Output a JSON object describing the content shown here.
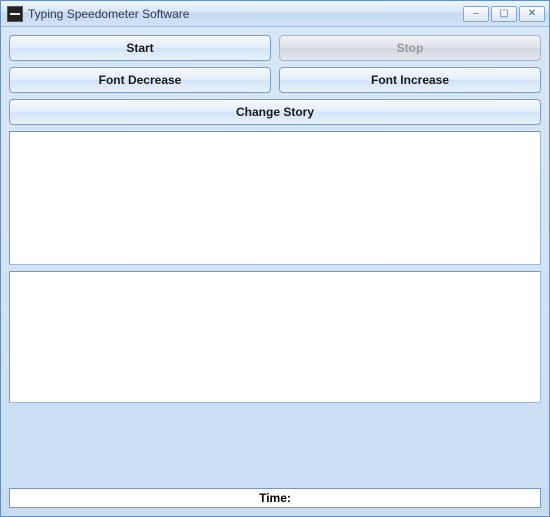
{
  "window": {
    "title": "Typing Speedometer Software"
  },
  "buttons": {
    "start": "Start",
    "stop": "Stop",
    "font_decrease": "Font Decrease",
    "font_increase": "Font Increase",
    "change_story": "Change Story"
  },
  "textareas": {
    "story": "",
    "input": ""
  },
  "status": {
    "time_label": "Time:"
  },
  "icons": {
    "app": "app-icon",
    "minimize": "–",
    "maximize": "▢",
    "close": "✕"
  }
}
